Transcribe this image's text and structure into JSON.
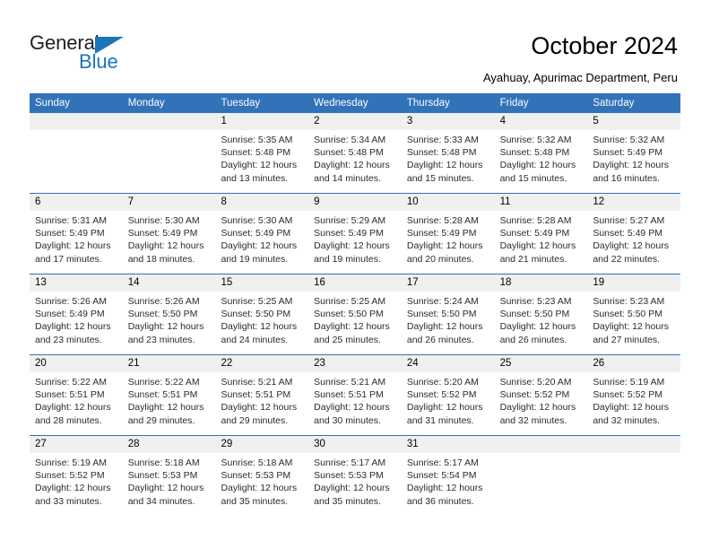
{
  "brand": {
    "name_part1": "General",
    "name_part2": "Blue",
    "color_dark": "#231f20",
    "color_blue": "#1b75bb"
  },
  "header": {
    "title": "October 2024",
    "subtitle": "Ayahuay, Apurimac Department, Peru"
  },
  "calendar": {
    "accent_color": "#3172b9",
    "daynum_band_color": "#f0f0f0",
    "weekday_headers": [
      "Sunday",
      "Monday",
      "Tuesday",
      "Wednesday",
      "Thursday",
      "Friday",
      "Saturday"
    ],
    "weeks": [
      [
        {
          "day": "",
          "empty": true,
          "sunrise": "",
          "sunset": "",
          "daylight_line1": "",
          "daylight_line2": ""
        },
        {
          "day": "",
          "empty": true,
          "sunrise": "",
          "sunset": "",
          "daylight_line1": "",
          "daylight_line2": ""
        },
        {
          "day": "1",
          "empty": false,
          "sunrise": "Sunrise: 5:35 AM",
          "sunset": "Sunset: 5:48 PM",
          "daylight_line1": "Daylight: 12 hours",
          "daylight_line2": "and 13 minutes."
        },
        {
          "day": "2",
          "empty": false,
          "sunrise": "Sunrise: 5:34 AM",
          "sunset": "Sunset: 5:48 PM",
          "daylight_line1": "Daylight: 12 hours",
          "daylight_line2": "and 14 minutes."
        },
        {
          "day": "3",
          "empty": false,
          "sunrise": "Sunrise: 5:33 AM",
          "sunset": "Sunset: 5:48 PM",
          "daylight_line1": "Daylight: 12 hours",
          "daylight_line2": "and 15 minutes."
        },
        {
          "day": "4",
          "empty": false,
          "sunrise": "Sunrise: 5:32 AM",
          "sunset": "Sunset: 5:48 PM",
          "daylight_line1": "Daylight: 12 hours",
          "daylight_line2": "and 15 minutes."
        },
        {
          "day": "5",
          "empty": false,
          "sunrise": "Sunrise: 5:32 AM",
          "sunset": "Sunset: 5:49 PM",
          "daylight_line1": "Daylight: 12 hours",
          "daylight_line2": "and 16 minutes."
        }
      ],
      [
        {
          "day": "6",
          "empty": false,
          "sunrise": "Sunrise: 5:31 AM",
          "sunset": "Sunset: 5:49 PM",
          "daylight_line1": "Daylight: 12 hours",
          "daylight_line2": "and 17 minutes."
        },
        {
          "day": "7",
          "empty": false,
          "sunrise": "Sunrise: 5:30 AM",
          "sunset": "Sunset: 5:49 PM",
          "daylight_line1": "Daylight: 12 hours",
          "daylight_line2": "and 18 minutes."
        },
        {
          "day": "8",
          "empty": false,
          "sunrise": "Sunrise: 5:30 AM",
          "sunset": "Sunset: 5:49 PM",
          "daylight_line1": "Daylight: 12 hours",
          "daylight_line2": "and 19 minutes."
        },
        {
          "day": "9",
          "empty": false,
          "sunrise": "Sunrise: 5:29 AM",
          "sunset": "Sunset: 5:49 PM",
          "daylight_line1": "Daylight: 12 hours",
          "daylight_line2": "and 19 minutes."
        },
        {
          "day": "10",
          "empty": false,
          "sunrise": "Sunrise: 5:28 AM",
          "sunset": "Sunset: 5:49 PM",
          "daylight_line1": "Daylight: 12 hours",
          "daylight_line2": "and 20 minutes."
        },
        {
          "day": "11",
          "empty": false,
          "sunrise": "Sunrise: 5:28 AM",
          "sunset": "Sunset: 5:49 PM",
          "daylight_line1": "Daylight: 12 hours",
          "daylight_line2": "and 21 minutes."
        },
        {
          "day": "12",
          "empty": false,
          "sunrise": "Sunrise: 5:27 AM",
          "sunset": "Sunset: 5:49 PM",
          "daylight_line1": "Daylight: 12 hours",
          "daylight_line2": "and 22 minutes."
        }
      ],
      [
        {
          "day": "13",
          "empty": false,
          "sunrise": "Sunrise: 5:26 AM",
          "sunset": "Sunset: 5:49 PM",
          "daylight_line1": "Daylight: 12 hours",
          "daylight_line2": "and 23 minutes."
        },
        {
          "day": "14",
          "empty": false,
          "sunrise": "Sunrise: 5:26 AM",
          "sunset": "Sunset: 5:50 PM",
          "daylight_line1": "Daylight: 12 hours",
          "daylight_line2": "and 23 minutes."
        },
        {
          "day": "15",
          "empty": false,
          "sunrise": "Sunrise: 5:25 AM",
          "sunset": "Sunset: 5:50 PM",
          "daylight_line1": "Daylight: 12 hours",
          "daylight_line2": "and 24 minutes."
        },
        {
          "day": "16",
          "empty": false,
          "sunrise": "Sunrise: 5:25 AM",
          "sunset": "Sunset: 5:50 PM",
          "daylight_line1": "Daylight: 12 hours",
          "daylight_line2": "and 25 minutes."
        },
        {
          "day": "17",
          "empty": false,
          "sunrise": "Sunrise: 5:24 AM",
          "sunset": "Sunset: 5:50 PM",
          "daylight_line1": "Daylight: 12 hours",
          "daylight_line2": "and 26 minutes."
        },
        {
          "day": "18",
          "empty": false,
          "sunrise": "Sunrise: 5:23 AM",
          "sunset": "Sunset: 5:50 PM",
          "daylight_line1": "Daylight: 12 hours",
          "daylight_line2": "and 26 minutes."
        },
        {
          "day": "19",
          "empty": false,
          "sunrise": "Sunrise: 5:23 AM",
          "sunset": "Sunset: 5:50 PM",
          "daylight_line1": "Daylight: 12 hours",
          "daylight_line2": "and 27 minutes."
        }
      ],
      [
        {
          "day": "20",
          "empty": false,
          "sunrise": "Sunrise: 5:22 AM",
          "sunset": "Sunset: 5:51 PM",
          "daylight_line1": "Daylight: 12 hours",
          "daylight_line2": "and 28 minutes."
        },
        {
          "day": "21",
          "empty": false,
          "sunrise": "Sunrise: 5:22 AM",
          "sunset": "Sunset: 5:51 PM",
          "daylight_line1": "Daylight: 12 hours",
          "daylight_line2": "and 29 minutes."
        },
        {
          "day": "22",
          "empty": false,
          "sunrise": "Sunrise: 5:21 AM",
          "sunset": "Sunset: 5:51 PM",
          "daylight_line1": "Daylight: 12 hours",
          "daylight_line2": "and 29 minutes."
        },
        {
          "day": "23",
          "empty": false,
          "sunrise": "Sunrise: 5:21 AM",
          "sunset": "Sunset: 5:51 PM",
          "daylight_line1": "Daylight: 12 hours",
          "daylight_line2": "and 30 minutes."
        },
        {
          "day": "24",
          "empty": false,
          "sunrise": "Sunrise: 5:20 AM",
          "sunset": "Sunset: 5:52 PM",
          "daylight_line1": "Daylight: 12 hours",
          "daylight_line2": "and 31 minutes."
        },
        {
          "day": "25",
          "empty": false,
          "sunrise": "Sunrise: 5:20 AM",
          "sunset": "Sunset: 5:52 PM",
          "daylight_line1": "Daylight: 12 hours",
          "daylight_line2": "and 32 minutes."
        },
        {
          "day": "26",
          "empty": false,
          "sunrise": "Sunrise: 5:19 AM",
          "sunset": "Sunset: 5:52 PM",
          "daylight_line1": "Daylight: 12 hours",
          "daylight_line2": "and 32 minutes."
        }
      ],
      [
        {
          "day": "27",
          "empty": false,
          "sunrise": "Sunrise: 5:19 AM",
          "sunset": "Sunset: 5:52 PM",
          "daylight_line1": "Daylight: 12 hours",
          "daylight_line2": "and 33 minutes."
        },
        {
          "day": "28",
          "empty": false,
          "sunrise": "Sunrise: 5:18 AM",
          "sunset": "Sunset: 5:53 PM",
          "daylight_line1": "Daylight: 12 hours",
          "daylight_line2": "and 34 minutes."
        },
        {
          "day": "29",
          "empty": false,
          "sunrise": "Sunrise: 5:18 AM",
          "sunset": "Sunset: 5:53 PM",
          "daylight_line1": "Daylight: 12 hours",
          "daylight_line2": "and 35 minutes."
        },
        {
          "day": "30",
          "empty": false,
          "sunrise": "Sunrise: 5:17 AM",
          "sunset": "Sunset: 5:53 PM",
          "daylight_line1": "Daylight: 12 hours",
          "daylight_line2": "and 35 minutes."
        },
        {
          "day": "31",
          "empty": false,
          "sunrise": "Sunrise: 5:17 AM",
          "sunset": "Sunset: 5:54 PM",
          "daylight_line1": "Daylight: 12 hours",
          "daylight_line2": "and 36 minutes."
        },
        {
          "day": "",
          "empty": true,
          "sunrise": "",
          "sunset": "",
          "daylight_line1": "",
          "daylight_line2": ""
        },
        {
          "day": "",
          "empty": true,
          "sunrise": "",
          "sunset": "",
          "daylight_line1": "",
          "daylight_line2": ""
        }
      ]
    ]
  }
}
